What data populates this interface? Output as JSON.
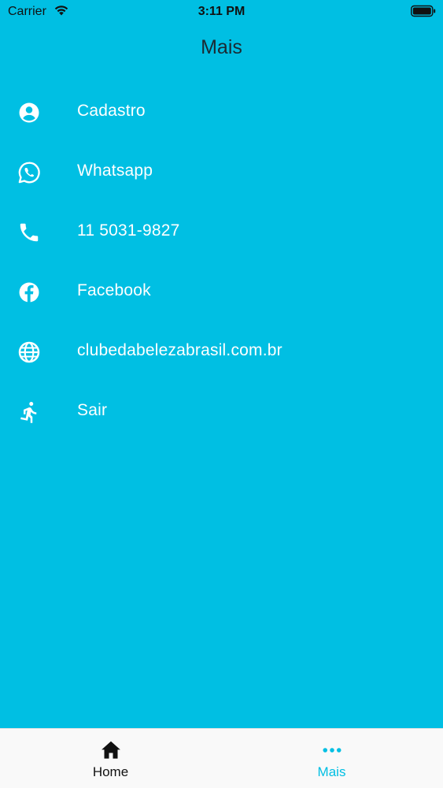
{
  "status_bar": {
    "carrier": "Carrier",
    "time": "3:11 PM"
  },
  "header": {
    "title": "Mais"
  },
  "menu": {
    "items": [
      {
        "label": "Cadastro",
        "icon": "account-circle-icon"
      },
      {
        "label": "Whatsapp",
        "icon": "whatsapp-icon"
      },
      {
        "label": "11 5031-9827",
        "icon": "phone-icon"
      },
      {
        "label": "Facebook",
        "icon": "facebook-icon"
      },
      {
        "label": "clubedabelezabrasil.com.br",
        "icon": "globe-icon"
      },
      {
        "label": "Sair",
        "icon": "running-person-icon"
      }
    ]
  },
  "tab_bar": {
    "tabs": [
      {
        "label": "Home",
        "icon": "home-icon",
        "active": false
      },
      {
        "label": "Mais",
        "icon": "more-dots-icon",
        "active": true
      }
    ]
  },
  "colors": {
    "background": "#00BFE3",
    "tab_active": "#00BFE3",
    "tab_bar_bg": "#F9F9F9"
  }
}
